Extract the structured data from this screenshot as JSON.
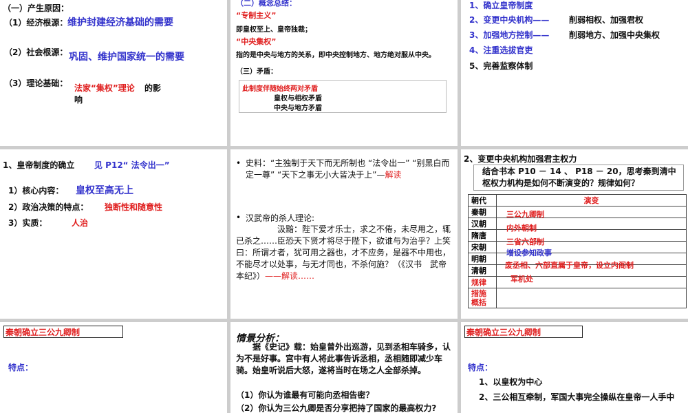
{
  "p1": {
    "heading": "（一）产生原因：",
    "r1_label": "（1）经济根源：",
    "r1_value": "维护封建经济基础的需要",
    "r2_label": "（2）社会根源：",
    "r2_value": "巩固、维护国家统一的需要",
    "r3_label": "（3）理论基础：",
    "r3_value_a": "法家“集权”理论",
    "r3_value_b": "的影",
    "r3_value_c": "响"
  },
  "p2": {
    "heading": "（二）概念总结：",
    "term1": "“专制主义”",
    "def1": "即皇权至上、皇帝独裁；",
    "term2": "“中央集权”",
    "def2": "指的是中央与地方的关系，即中央控制地方、地方绝对服从中央。",
    "sub": "（三）矛盾：",
    "box_title": "此制度伴随始终两对矛盾",
    "box_l1": "皇权与相权矛盾",
    "box_l2": "中央与地方矛盾"
  },
  "p3": {
    "items": [
      "1、确立皇帝制度",
      "2、变更中央机构——",
      "3、加强地方控制——",
      "4、注重选拔官吏",
      "5、完善监察体制"
    ],
    "note2": "削弱相权、加强君权",
    "note3": "削弱地方、加强中央集权"
  },
  "p4": {
    "title": "1、皇帝制度的确立",
    "ref": "见 P12“ 法令出一”",
    "l1_label": "1）核心内容：",
    "l1_value": "皇权至高无上",
    "l2_label": "2）政治决策的特点：",
    "l2_value": "独断性和随意性",
    "l3_label": "3）实质：",
    "l3_value": "人治"
  },
  "p5": {
    "b1_text": "史料：“主独制于天下而无所制也 “法令出一” “别黑白而定一尊” “天下之事无小大皆决于上”—",
    "b1_red": "解读",
    "b2_head": "汉武帝的杀人理论:",
    "b2_body": "汲黯：陛下爱才乐士，求之不倦，未尽用之，辄已杀之……臣恐天下贤才将尽于陛下，欲谁与为治乎？上笑曰：所谓才者，犹可用之器也，才不应务，是器不中用也，不能尽才以处事，与无才同也，不杀何施？（《汉书　武帝本纪》）",
    "b2_red": "——解读……"
  },
  "p6": {
    "title": "2、变更中央机构加强君主权力",
    "question": "结合书本 P10 － 14 、 P18 － 20，思考秦到清中枢权力机构是如何不断演变的？规律如何？",
    "col1": "朝代",
    "col2": "演变",
    "rows": [
      "秦朝",
      "汉朝",
      "隋唐",
      "宋朝",
      "明朝",
      "清朝"
    ],
    "law": "规律",
    "measure": "措施概括",
    "ov": [
      "三公九卿制",
      "内外朝制",
      "三省六部制",
      "增设参知政事",
      "废丞相、六部直属于皇帝，设立内阁制",
      "军机处"
    ]
  },
  "p7": {
    "title": "秦朝确立三公九卿制",
    "label": "特点："
  },
  "p8": {
    "title": "情景分析：",
    "body": "据《史记》载：始皇曾外出巡游，见到丞相车骑多，认为不是好事。宫中有人将此事告诉丞相，丞相随即减少车骑。始皇听说后大怒，遂将当时在场之人全部杀掉。",
    "q1": "（1）你认为谁最有可能向丞相告密？",
    "q2": "（2）你认为三公九卿是否分享把持了国家的最高权力?"
  },
  "p9": {
    "title": "秦朝确立三公九卿制",
    "label": "特点：",
    "l1": "1、以皇权为中心",
    "l2": "2、三公相互牵制，军国大事完全操纵在皇帝一人手中"
  }
}
